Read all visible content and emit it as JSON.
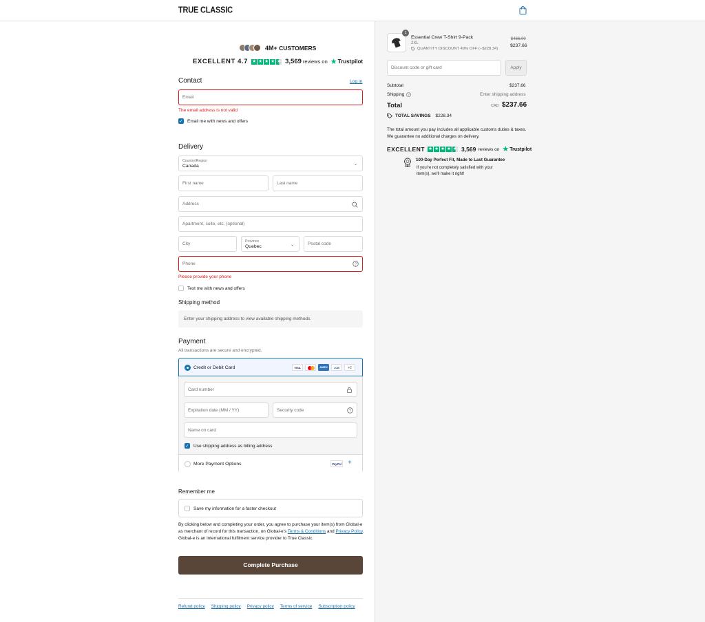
{
  "header": {
    "logo": "TRUE CLASSIC",
    "cart_icon": "shopping-bag-icon"
  },
  "social_proof": {
    "customers_count": "4M+",
    "customers_label": "CUSTOMERS",
    "excellent": "EXCELLENT 4.7",
    "review_count": "3,569",
    "reviews_on": "reviews on",
    "trustpilot": "Trustpilot",
    "rating": 4.7
  },
  "contact": {
    "title": "Contact",
    "login": "Log in",
    "email_placeholder": "Email",
    "email_error": "The email address is not valid",
    "news_label": "Email me with news and offers",
    "news_checked": true
  },
  "delivery": {
    "title": "Delivery",
    "country_label": "Country/Region",
    "country_value": "Canada",
    "first_name": "First name",
    "last_name": "Last name",
    "address": "Address",
    "apartment": "Apartment, suite, etc. (optional)",
    "city": "City",
    "province_label": "Province",
    "province_value": "Quebec",
    "postal": "Postal code",
    "phone": "Phone",
    "phone_error": "Please provide your phone",
    "text_label": "Text me with news and offers",
    "text_checked": false
  },
  "shipping": {
    "title": "Shipping method",
    "message": "Enter your shipping address to view available shipping methods."
  },
  "payment": {
    "title": "Payment",
    "subtitle": "All transactions are secure and encrypted.",
    "card_option": "Credit or Debit Card",
    "card_logos": [
      "VISA",
      "MC",
      "AMEX",
      "JCB"
    ],
    "more_cards": "+2",
    "card_number": "Card number",
    "expiration": "Expiration date (MM / YY)",
    "security": "Security code",
    "name_on_card": "Name on card",
    "billing_same": "Use shipping address as billing address",
    "billing_checked": true,
    "more_options": "More Payment Options",
    "paypal": "PayPal"
  },
  "remember": {
    "title": "Remember me",
    "save_label": "Save my information for a faster checkout"
  },
  "legal": {
    "text1": "By clicking below and completing your order, you agree to purchase your item(s) from Global-e as merchant of record for this transaction, on Global-e's ",
    "terms": "Terms & Conditions",
    "and": " and ",
    "privacy": "Privacy Policy",
    "text2": ". Global-e is an international fulfilment service provider to True Classic."
  },
  "complete_button": "Complete Purchase",
  "footer": {
    "links": [
      "Refund policy",
      "Shipping policy",
      "Privacy policy",
      "Terms of service",
      "Subscription policy"
    ]
  },
  "order": {
    "quantity": "1",
    "item_name": "Essential Crew T-Shirt 9-Pack",
    "size": "2XL",
    "discount": "QUANTITY DISCOUNT 49% OFF (−$228.34)",
    "original_price": "$466.00",
    "price": "$237.66",
    "discount_placeholder": "Discount code or gift card",
    "apply": "Apply",
    "subtotal_label": "Subtotal",
    "subtotal": "$237.66",
    "shipping_label": "Shipping",
    "shipping_value": "Enter shipping address",
    "total_label": "Total",
    "currency": "CAD",
    "total": "$237.66",
    "savings_label": "TOTAL SAVINGS",
    "savings": "$228.34",
    "customs_note": "The total amount you pay includes all applicable customs duties & taxes. We guarantee no additional charges on delivery.",
    "tp_excellent": "EXCELLENT",
    "tp_count": "3,569",
    "tp_reviews_on": "reviews on",
    "tp_brand": "Trustpilot",
    "guarantee_title": "100-Day Perfect Fit, Made to Last Guarantee",
    "guarantee_text": "If you're not completely satisfied with your item(s), we'll make it right!"
  },
  "colors": {
    "accent": "#1773b0",
    "error": "#dd1d1d",
    "button": "#5a4639",
    "trustpilot": "#00b67a"
  }
}
